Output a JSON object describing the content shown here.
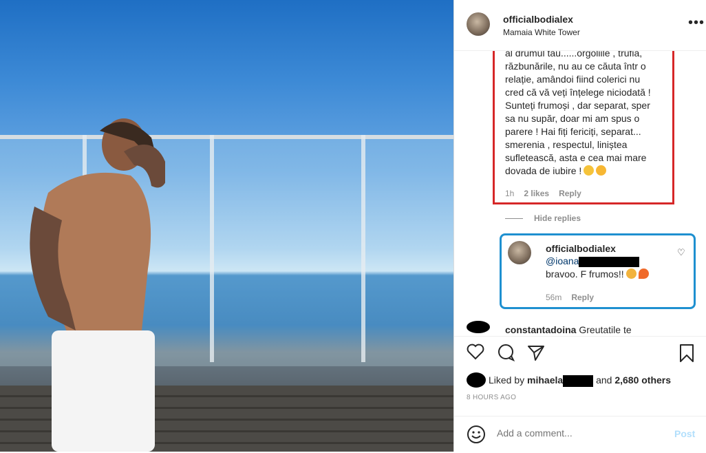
{
  "post": {
    "username": "officialbodialex",
    "location": "Mamaia White Tower",
    "more_label": "•••"
  },
  "comment1": {
    "lines": [
      "al drumul tău......orgoliile , trufia,",
      "răzbunările, nu au ce căuta într o",
      "relație, amândoi fiind colerici nu",
      "cred că vă veți înțelege niciodată !",
      "Sunteți frumoși , dar separat, sper",
      "sa nu supăr, doar mi am spus o",
      "parere ! Hai fiți fericiți, separat...",
      "smerenia , respectul, liniștea",
      "sufletească, asta e cea mai mare",
      "dovada de iubire !"
    ],
    "time": "1h",
    "likes": "2 likes",
    "reply": "Reply"
  },
  "hide_replies": "Hide replies",
  "reply1": {
    "username": "officialbodialex",
    "mention": "@ioana",
    "text": "bravoo. F frumos!!",
    "time": "56m",
    "reply": "Reply"
  },
  "comment2": {
    "username": "constantadoina",
    "text": "Greutatile te"
  },
  "likes": {
    "prefix": "Liked by",
    "user": "mihaela",
    "and": "and",
    "count": "2,680 others"
  },
  "time_ago": "8 HOURS AGO",
  "add_comment": {
    "placeholder": "Add a comment...",
    "post_label": "Post"
  },
  "colors": {
    "highlight_red": "#d62728",
    "highlight_blue": "#1e90d0",
    "post_button": "#b2dffc"
  }
}
